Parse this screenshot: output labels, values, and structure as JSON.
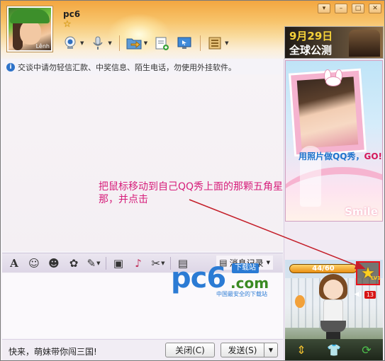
{
  "contact": {
    "nickname": "pc6",
    "avatar_tag": "Lênh"
  },
  "toolbar": {
    "items": [
      {
        "icon": "webcam-icon",
        "has_dropdown": true
      },
      {
        "icon": "microphone-icon",
        "has_dropdown": true
      },
      {
        "icon": "file-transfer-icon",
        "has_dropdown": true
      },
      {
        "icon": "notepad-add-icon",
        "has_dropdown": false
      },
      {
        "icon": "remote-desktop-icon",
        "has_dropdown": false
      },
      {
        "icon": "apps-icon",
        "has_dropdown": true
      }
    ]
  },
  "window_buttons": {
    "menu": "▾",
    "minimize": "–",
    "maximize": "□",
    "close": "✕"
  },
  "notice": "交谈中请勿轻信汇款、中奖信息、陌生电话，勿使用外挂软件。",
  "annotation": "把鼠标移动到自己QQ秀上面的那颗五角星那，并点击",
  "input_toolbar": {
    "history_label": "消息记录",
    "items": [
      "font-icon",
      "emoji-icon",
      "magic-face-icon",
      "sticker-icon",
      "screenshot-edit-icon",
      "image-icon",
      "music-icon",
      "scissors-icon",
      "doc-icon"
    ]
  },
  "watermark": {
    "brand": "pc6",
    "domain": ".com",
    "badge": "下载站",
    "slogan": "中国最安全的下载站"
  },
  "footer": {
    "message": "快来，萌妹带你闯三国!",
    "close_label": "关闭(C)",
    "send_label": "发送(S)",
    "send_dropdown": "▼"
  },
  "ads": {
    "top_date": "9月29日",
    "top_sub": "全球公测",
    "main_text": "用照片做QQ秀，",
    "main_go": "GO!",
    "main_smile": "Smile"
  },
  "qq_show": {
    "level_text": "44/60",
    "star": "★",
    "level_tag": "LV1",
    "count_badge": "13",
    "speaker": "◀)"
  },
  "colors": {
    "annotation": "#d61d7a",
    "highlight_box": "#e8131c",
    "arrow": "#c41f2a"
  }
}
